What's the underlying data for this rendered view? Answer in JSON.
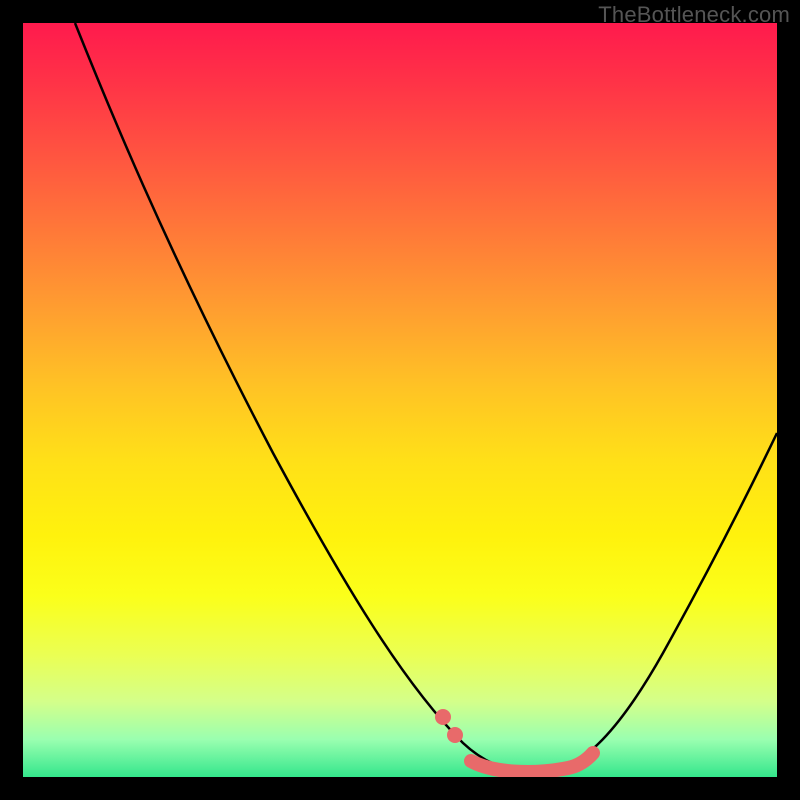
{
  "watermark": "TheBottleneck.com",
  "chart_data": {
    "type": "line",
    "title": "",
    "xlabel": "",
    "ylabel": "",
    "xlim": [
      0,
      100
    ],
    "ylim": [
      0,
      100
    ],
    "background_gradient": {
      "top": "#ff1a4d",
      "bottom": "#34e68c"
    },
    "series": [
      {
        "name": "bottleneck-curve",
        "x": [
          7,
          12,
          20,
          30,
          40,
          48,
          54,
          58,
          62,
          66,
          70,
          75,
          80,
          86,
          92,
          98
        ],
        "y": [
          100,
          90,
          76,
          58,
          40,
          25,
          12,
          6,
          2,
          1,
          1,
          2,
          6,
          15,
          30,
          49
        ]
      }
    ],
    "highlight": {
      "name": "optimal-range",
      "color": "#e86a6a",
      "x_range": [
        55,
        77
      ],
      "dots_x": [
        55.5,
        57.5
      ],
      "flat_segment_x": [
        60,
        74
      ]
    }
  }
}
